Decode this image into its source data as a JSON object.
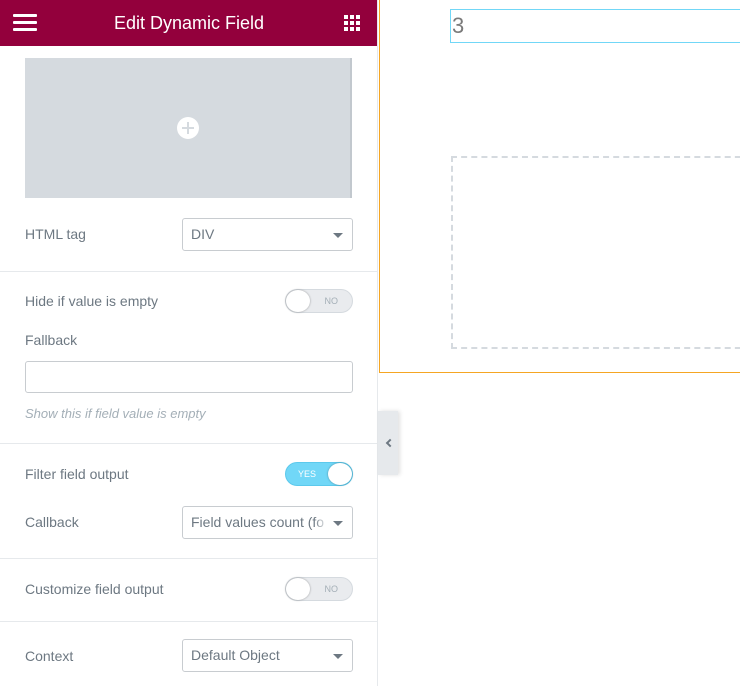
{
  "panel": {
    "title": "Edit Dynamic Field",
    "menu_icon": "hamburger-icon",
    "apps_icon": "grid-icon",
    "image_placeholder_icon": "plus-circle-icon",
    "html_tag": {
      "label": "HTML tag",
      "value": "DIV"
    },
    "hide_if_empty": {
      "label": "Hide if value is empty",
      "state": "NO"
    },
    "fallback": {
      "label": "Fallback",
      "value": "",
      "help": "Show this if field value is empty"
    },
    "filter_output": {
      "label": "Filter field output",
      "state": "YES"
    },
    "callback": {
      "label": "Callback",
      "value": "Field values count (fo"
    },
    "customize_output": {
      "label": "Customize field output",
      "state": "NO"
    },
    "context": {
      "label": "Context",
      "value": "Default Object"
    },
    "collapse_icon": "chevron-left-icon"
  },
  "preview": {
    "field_value": "3"
  },
  "colors": {
    "header_bg": "#93003c",
    "toggle_on": "#71d7f7",
    "section_outline": "#f5a623",
    "field_outline": "#71d7f7"
  }
}
